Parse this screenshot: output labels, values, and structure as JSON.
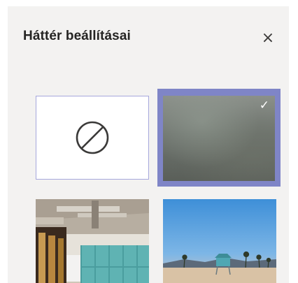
{
  "panel": {
    "title": "Háttér beállításai",
    "close_glyph": "×",
    "close_icon": "close-icon"
  },
  "backgrounds": [
    {
      "id": "none",
      "icon": "no-background-icon",
      "selected": false
    },
    {
      "id": "blur",
      "icon": "blur-background-thumbnail",
      "selected": true,
      "check_glyph": "✓"
    },
    {
      "id": "office",
      "icon": "office-background-thumbnail",
      "selected": false
    },
    {
      "id": "beach",
      "icon": "beach-background-thumbnail",
      "selected": false
    }
  ],
  "colors": {
    "panel_bg": "#f3f2f1",
    "selected_border": "#7f85c7",
    "none_border": "#a6a7dc",
    "title_text": "#252423"
  }
}
